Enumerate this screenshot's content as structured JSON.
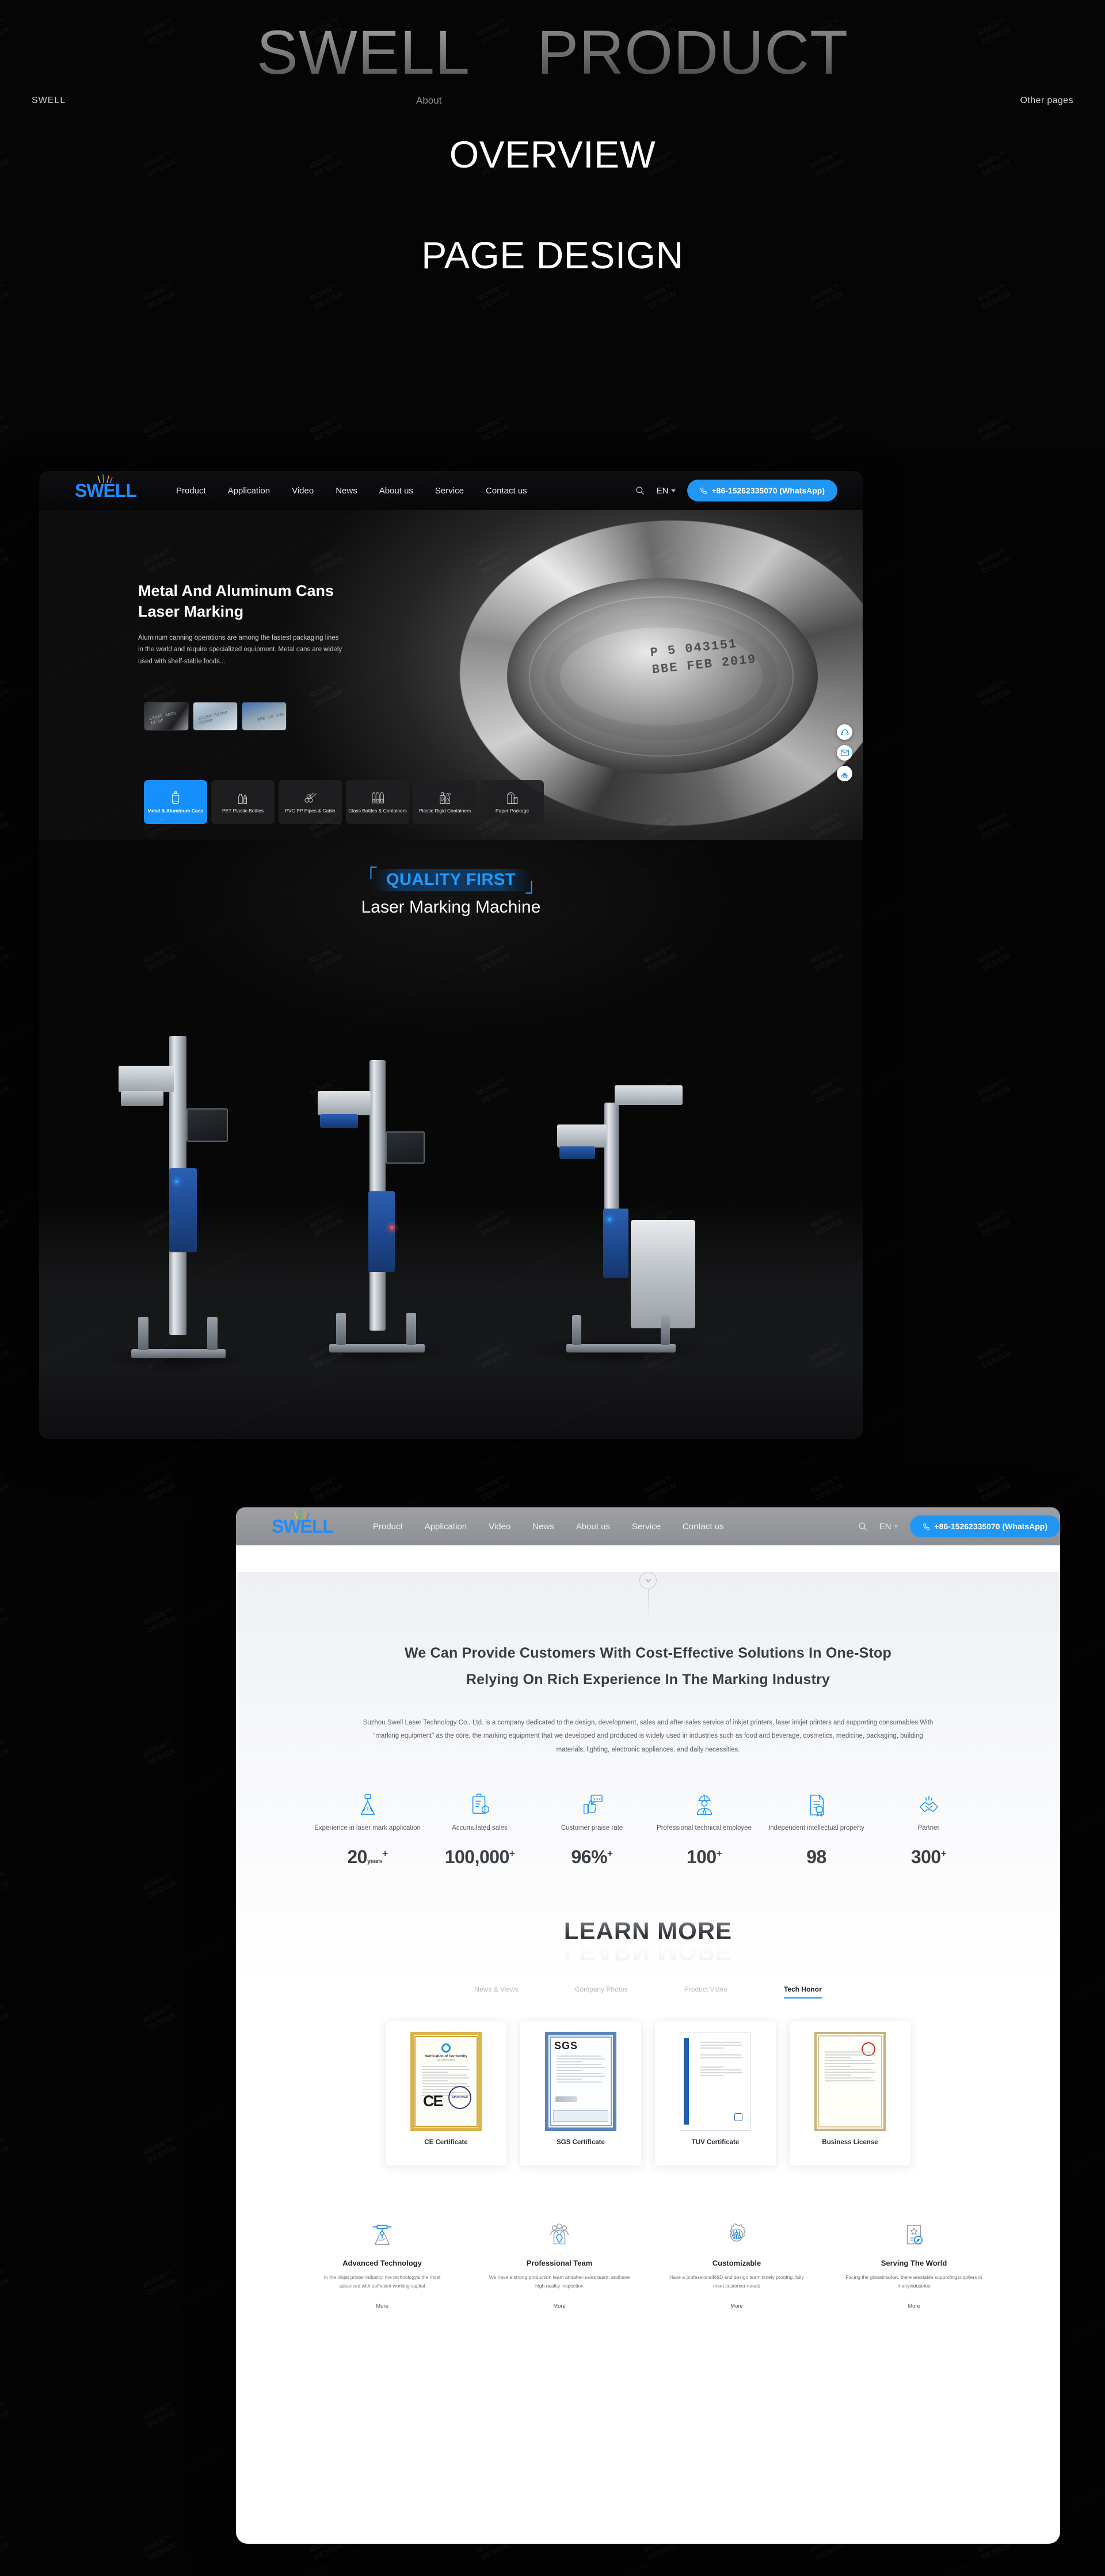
{
  "banner": {
    "left_label": "SWELL",
    "about_label": "About",
    "right_label": "Other pages",
    "title_part1": "SWELL",
    "title_part2": "PRODUCT",
    "line2": "OVERVIEW",
    "line3": "PAGE DESIGN"
  },
  "nav": {
    "logo": "SWELL",
    "links": [
      "Product",
      "Application",
      "Video",
      "News",
      "About us",
      "Service",
      "Contact us"
    ],
    "search_icon": "search-icon",
    "language": "EN",
    "phone_button": "+86-15262335070 (WhatsApp)",
    "phone_icon": "phone-icon"
  },
  "hero": {
    "title": "Metal And Aluminum Cans Laser Marking",
    "paragraph": "Aluminum canning operations are among the fastest packaging lines in the world and require specialized equipment. Metal cans are widely used with shelf-stable foods...",
    "can_code_line1": "P 5 043151",
    "can_code_line2": "BBE FEB 2019",
    "thumbnails": [
      {
        "name": "thumb-laser-code",
        "code": "L3165 ADC3\n12:07"
      },
      {
        "name": "thumb-pipes",
        "code": "S28MM\nS26MM\nS25MM"
      },
      {
        "name": "thumb-can-top",
        "code": "BBE 10 JUN"
      }
    ],
    "categories": [
      {
        "label": "Metal & Aluminum Cans",
        "icon": "can-icon",
        "active": true
      },
      {
        "label": "PET Plastic Bottles",
        "icon": "bottle-icon",
        "active": false
      },
      {
        "label": "PVC PP Pipes & Cable",
        "icon": "pipes-icon",
        "active": false
      },
      {
        "label": "Glass Bottles & Containers",
        "icon": "glass-bottles-icon",
        "active": false
      },
      {
        "label": "Plastic Rigid Containers",
        "icon": "spray-bottle-icon",
        "active": false
      },
      {
        "label": "Paper Package",
        "icon": "carton-icon",
        "active": false
      }
    ],
    "dock": [
      {
        "name": "support-headset-icon",
        "label": ""
      },
      {
        "name": "email-envelope-icon",
        "label": ""
      },
      {
        "name": "scroll-to-top-icon",
        "label": "TOP"
      }
    ]
  },
  "quality": {
    "badge": "QUALITY FIRST",
    "subtitle": "Laser Marking Machine"
  },
  "about": {
    "headline_line1": "We Can Provide Customers With Cost-Effective Solutions In One-Stop",
    "headline_line2": "Relying On Rich Experience In The Marking Industry",
    "paragraph": "Suzhou Swell Laser Technology Co., Ltd. is a company dedicated to the design, development, sales and after-sales service of inkjet printers, laser inkjet printers and supporting consumables.With \"marking equipment\" as the core, the marking equipment that we developed and produced is widely used in industries such as food and beverage, cosmetics, medicine, packaging, building materials, lighting, electronic appliances, and daily necessities.",
    "scroll_icon": "chevron-down-icon"
  },
  "stats": [
    {
      "icon": "laser-marking-icon",
      "label": "Experience in laser mark application",
      "value": "20",
      "unit": "years",
      "plus": "+"
    },
    {
      "icon": "clipboard-box-icon",
      "label": "Accumulated sales",
      "value": "100,000",
      "unit": "",
      "plus": "+"
    },
    {
      "icon": "thumbs-up-stars-icon",
      "label": "Customer praise rate",
      "value": "96%",
      "unit": "",
      "plus": "+"
    },
    {
      "icon": "engineer-icon",
      "label": "Professional technical employee",
      "value": "100",
      "unit": "",
      "plus": "+"
    },
    {
      "icon": "certificate-doc-icon",
      "label": "Independent intellectual property",
      "value": "98",
      "unit": "",
      "plus": ""
    },
    {
      "icon": "handshake-icon",
      "label": "Partner",
      "value": "300",
      "unit": "",
      "plus": "+"
    }
  ],
  "learn_more": {
    "heading": "LEARN MORE",
    "tabs": [
      {
        "label": "News & Views",
        "active": false
      },
      {
        "label": "Company Photos",
        "active": false
      },
      {
        "label": "Product Video",
        "active": false
      },
      {
        "label": "Tech Honor",
        "active": true
      }
    ]
  },
  "certificates": [
    {
      "name": "CE Certificate",
      "kind": "ce",
      "doc_title": "Verification of Conformity",
      "mark": "CE",
      "stamp": "APPROVED"
    },
    {
      "name": "SGS Certificate",
      "kind": "sgs",
      "doc_title": "SGS",
      "mark": "",
      "stamp": ""
    },
    {
      "name": "TUV Certificate",
      "kind": "tuv",
      "doc_title": "",
      "mark": "",
      "stamp": ""
    },
    {
      "name": "Business License",
      "kind": "biz",
      "doc_title": "",
      "mark": "",
      "stamp": ""
    }
  ],
  "features": [
    {
      "icon": "advanced-technology-icon",
      "title": "Advanced Technology",
      "desc": "In the inkjet printer industry, the technologyis the most advanced,with sufhcient working capital",
      "more": "More"
    },
    {
      "icon": "professional-team-icon",
      "title": "Professional Team",
      "desc": "We have a strong production team andafter-sales team, andhave high quality inspection",
      "more": "More"
    },
    {
      "icon": "customizable-gear-icon",
      "title": "Customizable",
      "desc": "Have a professionalR&D and design team,timely proofng, fully meet customer needs",
      "more": "More"
    },
    {
      "icon": "serving-the-world-icon",
      "title": "Serving The World",
      "desc": "Facing the globalmarket. there arestable supportingsuppliers in manyindustries",
      "more": "More"
    }
  ],
  "colors": {
    "accent_blue": "#1790ff",
    "page_black": "#040404",
    "nav_dark": "#0e0f12"
  }
}
